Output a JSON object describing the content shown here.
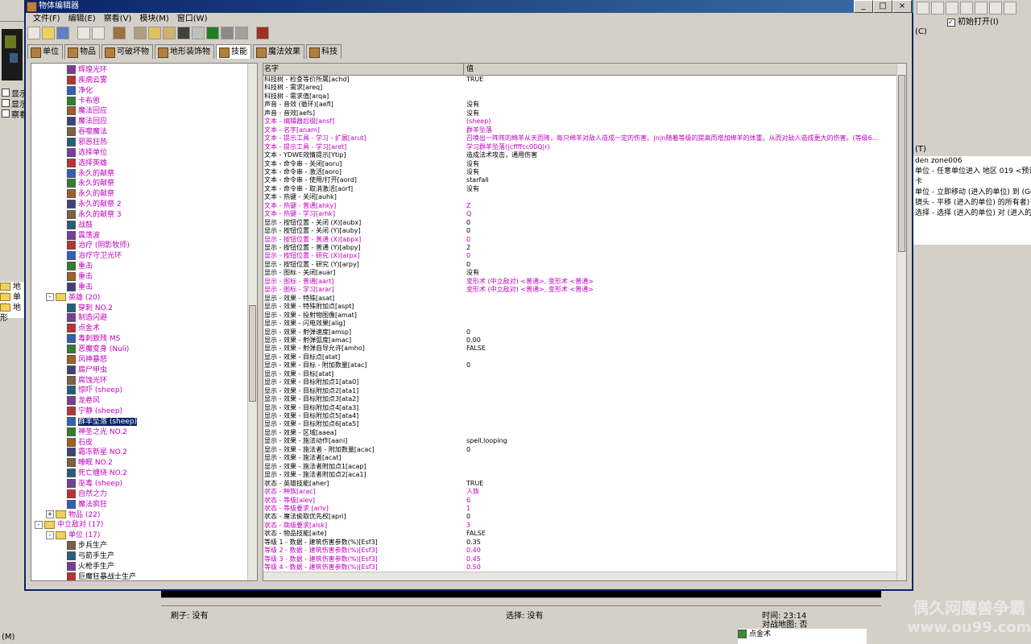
{
  "window": {
    "title": "物体编辑器"
  },
  "menu": [
    "文件(F)",
    "编辑(E)",
    "察看(V)",
    "模块(M)",
    "窗口(W)"
  ],
  "tabs": [
    "单位",
    "物品",
    "可破坏物",
    "地形装饰物",
    "技能",
    "魔法效果",
    "科技"
  ],
  "active_tab": 4,
  "right_panel": {
    "checkbox": "初始打开(I)",
    "c_label": "(C)",
    "t_label": "(T)",
    "lines": [
      "den zone006",
      "单位 - 任意单位进入 地区 019 <预设>",
      "单位 - 立即移动 (进入的单位) 到 (Ge",
      "镜头 - 平移 (进入的单位) 的所有者)",
      "选择 - 选择 (进入的单位) 对 (进入的"
    ]
  },
  "left_bg": {
    "checks": [
      "显示",
      "显示",
      "察看"
    ],
    "folders": [
      "地形",
      "单位",
      "地形"
    ],
    "bottom": "(M)"
  },
  "tree": [
    {
      "label": "辉煌光环",
      "indent": 2,
      "icon": "ability",
      "mag": true
    },
    {
      "label": "疾病云雾",
      "indent": 2,
      "icon": "ability",
      "mag": true
    },
    {
      "label": "净化",
      "indent": 2,
      "icon": "ability",
      "mag": true
    },
    {
      "label": "卡布恩",
      "indent": 2,
      "icon": "ability",
      "mag": true
    },
    {
      "label": "魔法回应",
      "indent": 2,
      "icon": "ability",
      "mag": true
    },
    {
      "label": "魔法回应",
      "indent": 2,
      "icon": "ability",
      "mag": true
    },
    {
      "label": "吞噬魔法",
      "indent": 2,
      "icon": "ability",
      "mag": true
    },
    {
      "label": "邪恶狂热",
      "indent": 2,
      "icon": "ability",
      "mag": true
    },
    {
      "label": "选择单位",
      "indent": 2,
      "icon": "ability",
      "mag": true
    },
    {
      "label": "选择英雄",
      "indent": 2,
      "icon": "ability",
      "mag": true
    },
    {
      "label": "永久的献祭",
      "indent": 2,
      "icon": "ability",
      "mag": true
    },
    {
      "label": "永久的献祭",
      "indent": 2,
      "icon": "ability",
      "mag": true
    },
    {
      "label": "永久的献祭",
      "indent": 2,
      "icon": "ability",
      "mag": true
    },
    {
      "label": "永久的献祭 2",
      "indent": 2,
      "icon": "ability",
      "mag": true
    },
    {
      "label": "永久的献祭 3",
      "indent": 2,
      "icon": "ability",
      "mag": true
    },
    {
      "label": "战鼓",
      "indent": 2,
      "icon": "ability",
      "mag": true
    },
    {
      "label": "震荡波",
      "indent": 2,
      "icon": "ability",
      "mag": true
    },
    {
      "label": "治疗 (阴影牧师)",
      "indent": 2,
      "icon": "ability",
      "mag": true
    },
    {
      "label": "治疗守卫光环",
      "indent": 2,
      "icon": "ability",
      "mag": true
    },
    {
      "label": "重击",
      "indent": 2,
      "icon": "ability",
      "mag": true
    },
    {
      "label": "重击",
      "indent": 2,
      "icon": "ability",
      "mag": true
    },
    {
      "label": "重击",
      "indent": 2,
      "icon": "ability",
      "mag": true
    },
    {
      "label": "英雄 (20)",
      "indent": 1,
      "icon": "folder",
      "mag": true,
      "exp": "-"
    },
    {
      "label": "穿刺 NO.2",
      "indent": 2,
      "icon": "ability",
      "mag": true
    },
    {
      "label": "制造闪避",
      "indent": 2,
      "icon": "ability",
      "mag": true
    },
    {
      "label": "点金术",
      "indent": 2,
      "icon": "ability",
      "mag": true
    },
    {
      "label": "毒刺致残 MS",
      "indent": 2,
      "icon": "ability",
      "mag": true
    },
    {
      "label": "恶魔变身 (Nuli)",
      "indent": 2,
      "icon": "ability",
      "mag": true
    },
    {
      "label": "风神暴怒",
      "indent": 2,
      "icon": "ability",
      "mag": true
    },
    {
      "label": "腐尸甲虫",
      "indent": 2,
      "icon": "ability",
      "mag": true
    },
    {
      "label": "腐蚀光环",
      "indent": 2,
      "icon": "ability",
      "mag": true
    },
    {
      "label": "惊吓 (sheep)",
      "indent": 2,
      "icon": "ability",
      "mag": true
    },
    {
      "label": "龙卷风",
      "indent": 2,
      "icon": "ability",
      "mag": true
    },
    {
      "label": "宁静 (sheep)",
      "indent": 2,
      "icon": "ability",
      "mag": true
    },
    {
      "label": "群羊坠落 (sheep)",
      "indent": 2,
      "icon": "ability",
      "mag": false,
      "selected": true
    },
    {
      "label": "神圣之光 NO.2",
      "indent": 2,
      "icon": "ability",
      "mag": true
    },
    {
      "label": "石皮",
      "indent": 2,
      "icon": "ability",
      "mag": true
    },
    {
      "label": "霜冻新星 NO.2",
      "indent": 2,
      "icon": "ability",
      "mag": true
    },
    {
      "label": "睡眠 NO.2",
      "indent": 2,
      "icon": "ability",
      "mag": true
    },
    {
      "label": "死亡缠绕 NO.2",
      "indent": 2,
      "icon": "ability",
      "mag": true
    },
    {
      "label": "巫毒 (sheep)",
      "indent": 2,
      "icon": "ability",
      "mag": true
    },
    {
      "label": "自然之力",
      "indent": 2,
      "icon": "ability",
      "mag": true
    },
    {
      "label": "魔法疯狂",
      "indent": 2,
      "icon": "ability",
      "mag": true
    },
    {
      "label": "物品 (22)",
      "indent": 1,
      "icon": "folder",
      "mag": true,
      "exp": "+"
    },
    {
      "label": "中立敌对 (17)",
      "indent": 0,
      "icon": "folder",
      "mag": true,
      "exp": "-"
    },
    {
      "label": "单位 (17)",
      "indent": 1,
      "icon": "folder",
      "mag": true,
      "exp": "-"
    },
    {
      "label": "步兵生产",
      "indent": 2,
      "icon": "ability",
      "mag": false
    },
    {
      "label": "弓箭手生产",
      "indent": 2,
      "icon": "ability",
      "mag": false
    },
    {
      "label": "火枪手生产",
      "indent": 2,
      "icon": "ability",
      "mag": false
    },
    {
      "label": "巨魔狂暴战士生产",
      "indent": 2,
      "icon": "ability",
      "mag": false
    }
  ],
  "grid": {
    "header_name": "名字",
    "header_value": "值",
    "rows": [
      {
        "n": "科技树 - 检查等价所属[achd]",
        "v": "TRUE"
      },
      {
        "n": "科技树 - 需求[areq]",
        "v": ""
      },
      {
        "n": "科技树 - 需求值[arqa]",
        "v": ""
      },
      {
        "n": "声音 - 音效 (循环)[aefl]",
        "v": "没有"
      },
      {
        "n": "声音 - 音效[aefs]",
        "v": "没有"
      },
      {
        "n": "文本 - 编辑器后缀[ansf]",
        "v": "(sheep)",
        "m": true
      },
      {
        "n": "文本 - 名字[anam]",
        "v": "群羊坠落",
        "m": true
      },
      {
        "n": "文本 - 提示工具 - 学习 - 扩展[arut]",
        "v": "召唤出一阵阵的绵羊从天而降，每只绵羊对敌人造成一定的伤害。|n|n随着等级的提高而增加绵羊的体重，从而对敌人造成更大的伤害。(等级6...",
        "m": true
      },
      {
        "n": "文本 - 提示工具 - 学习[aret]",
        "v": "学习群羊坠落(|cffffcc00Q|r)",
        "m": true
      },
      {
        "n": "文本 - YDWE效情提示[Ytip]",
        "v": "造成法术攻击，通用伤害"
      },
      {
        "n": "文本 - 命令串 - 关闭[aoru]",
        "v": "没有"
      },
      {
        "n": "文本 - 命令串 - 激活[aoro]",
        "v": "没有"
      },
      {
        "n": "文本 - 命令串 - 使用/打开[aord]",
        "v": "starfall"
      },
      {
        "n": "文本 - 命令串 - 取消激活[aorf]",
        "v": "没有"
      },
      {
        "n": "文本 - 热键 - 关闭[auhk]",
        "v": ""
      },
      {
        "n": "文本 - 热键 - 普通[ahky]",
        "v": "Z",
        "m": true
      },
      {
        "n": "文本 - 热键 - 学习[arhk]",
        "v": "Q",
        "m": true
      },
      {
        "n": "显示 - 按钮位置 - 关闭 (X)[aubx]",
        "v": "0"
      },
      {
        "n": "显示 - 按钮位置 - 关闭 (Y)[auby]",
        "v": "0"
      },
      {
        "n": "显示 - 按钮位置 - 普通 (X)[abpx]",
        "v": "0",
        "m": true
      },
      {
        "n": "显示 - 按钮位置 - 普通 (Y)[abpy]",
        "v": "2"
      },
      {
        "n": "显示 - 按钮位置 - 研究 (X)[arpx]",
        "v": "0",
        "m": true
      },
      {
        "n": "显示 - 按钮位置 - 研究 (Y)[arpy]",
        "v": "0"
      },
      {
        "n": "显示 - 图标 - 关闭[auar]",
        "v": "没有"
      },
      {
        "n": "显示 - 图标 - 普通[aart]",
        "v": "变形术 (中立敌对) <普通>, 变形术 <普通>",
        "m": true
      },
      {
        "n": "显示 - 图标 - 学习[arar]",
        "v": "变形术 (中立敌对) <普通>, 变形术 <普通>",
        "m": true
      },
      {
        "n": "显示 - 效果 - 特殊[asat]",
        "v": ""
      },
      {
        "n": "显示 - 效果 - 特殊附加点[aspt]",
        "v": ""
      },
      {
        "n": "显示 - 效果 - 投射物图像[amat]",
        "v": ""
      },
      {
        "n": "显示 - 效果 - 闪电效果[alig]",
        "v": ""
      },
      {
        "n": "显示 - 效果 - 射弹速度[amsp]",
        "v": "0"
      },
      {
        "n": "显示 - 效果 - 射弹弧度[amac]",
        "v": "0.00"
      },
      {
        "n": "显示 - 效果 - 射弹自导允许[amho]",
        "v": "FALSE"
      },
      {
        "n": "显示 - 效果 - 目标点[atat]",
        "v": ""
      },
      {
        "n": "显示 - 效果 - 目标 - 附加数量[atac]",
        "v": "0"
      },
      {
        "n": "显示 - 效果 - 目标[atat]",
        "v": ""
      },
      {
        "n": "显示 - 效果 - 目标附加点1[ata0]",
        "v": ""
      },
      {
        "n": "显示 - 效果 - 目标附加点2[ata1]",
        "v": ""
      },
      {
        "n": "显示 - 效果 - 目标附加点3[ata2]",
        "v": ""
      },
      {
        "n": "显示 - 效果 - 目标附加点4[ata3]",
        "v": ""
      },
      {
        "n": "显示 - 效果 - 目标附加点5[ata4]",
        "v": ""
      },
      {
        "n": "显示 - 效果 - 目标附加点6[ata5]",
        "v": ""
      },
      {
        "n": "显示 - 效果 - 区域[aaea]",
        "v": ""
      },
      {
        "n": "显示 - 效果 - 施法动作[aani]",
        "v": "spell,looping"
      },
      {
        "n": "显示 - 效果 - 施法者 - 附加数量[acac]",
        "v": "0"
      },
      {
        "n": "显示 - 效果 - 施法者[acat]",
        "v": ""
      },
      {
        "n": "显示 - 效果 - 施法者附加点1[acap]",
        "v": ""
      },
      {
        "n": "显示 - 效果 - 施法者附加点2[aca1]",
        "v": ""
      },
      {
        "n": "状态 - 英雄技能[aher]",
        "v": "TRUE"
      },
      {
        "n": "状态 - 种族[arac]",
        "v": "人族",
        "m": true
      },
      {
        "n": "状态 - 等级[alev]",
        "v": "6",
        "m": true
      },
      {
        "n": "状态 - 等级要求         [arlv]",
        "v": "1",
        "m": true
      },
      {
        "n": "状态 - 魔法偷取优先权[apri]",
        "v": "0"
      },
      {
        "n": "状态 - 跳级要求[alsk]",
        "v": "3",
        "m": true
      },
      {
        "n": "状态 - 物品技能[aite]",
        "v": "FALSE"
      },
      {
        "n": "等级 1 - 数据 - 建筑伤害参数(%)[Esf3]",
        "v": "0.35"
      },
      {
        "n": "等级 2 - 数据 - 建筑伤害参数(%)[Esf3]",
        "v": "0.40",
        "m": true
      },
      {
        "n": "等级 3 - 数据 - 建筑伤害参数(%)[Esf3]",
        "v": "0.45",
        "m": true
      },
      {
        "n": "等级 4 - 数据 - 建筑伤害参数(%)[Esf3]",
        "v": "0.50",
        "m": true
      }
    ]
  },
  "status": {
    "brush_label": "刷子: 没有",
    "select_label": "选择: 没有",
    "time_label": "时间: 23:14",
    "combat_map_label": "对战地图: 否"
  },
  "right_bottom": {
    "label": "点金术"
  },
  "watermark": {
    "line1": "偶久网魔兽争霸",
    "line2": "www.ou99.com"
  }
}
